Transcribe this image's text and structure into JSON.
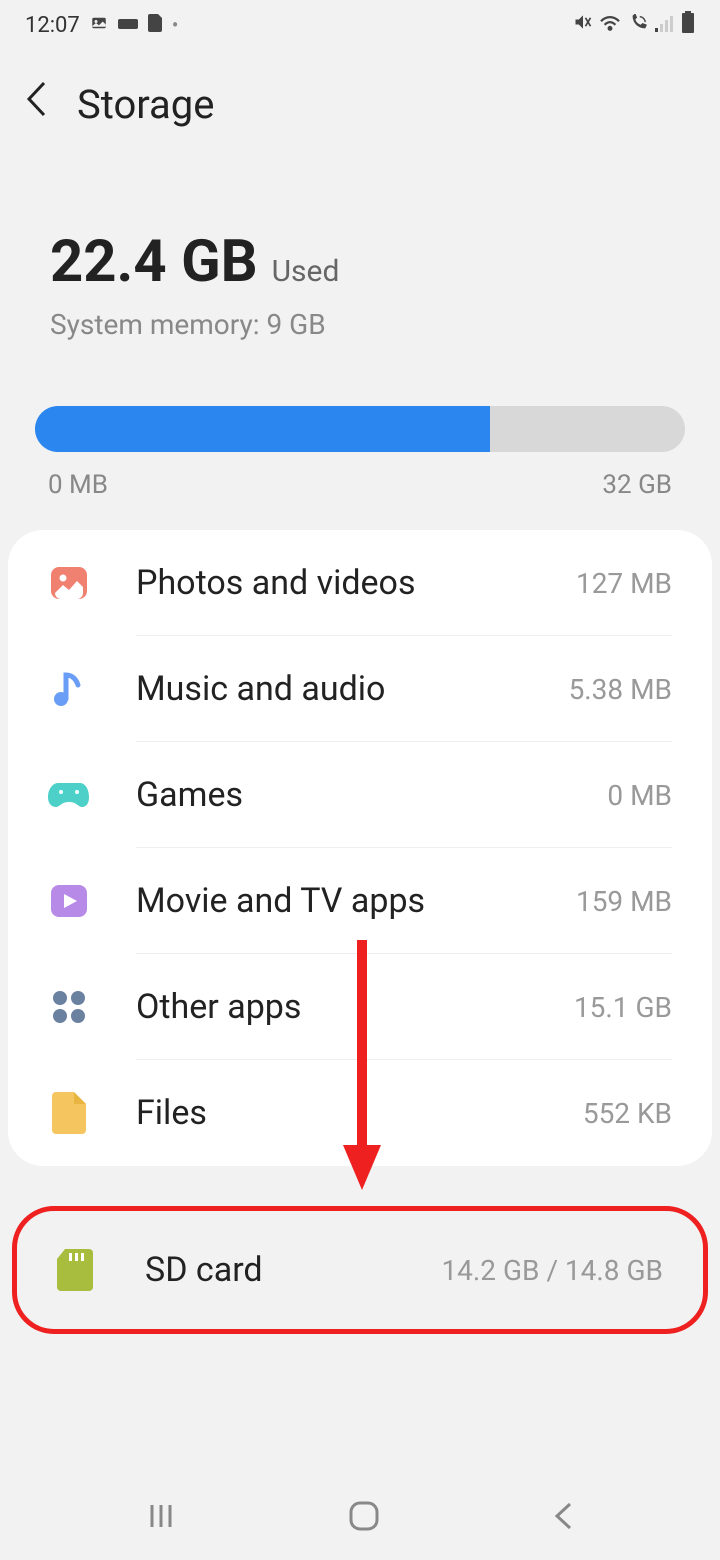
{
  "status_bar": {
    "time": "12:07"
  },
  "header": {
    "title": "Storage"
  },
  "summary": {
    "used_amount": "22.4 GB",
    "used_label": "Used",
    "system_memory": "System memory: 9 GB",
    "progress_percent": 70,
    "min_label": "0 MB",
    "max_label": "32 GB"
  },
  "categories": [
    {
      "id": "photos",
      "label": "Photos and videos",
      "value": "127 MB",
      "color": "#f08070"
    },
    {
      "id": "music",
      "label": "Music and audio",
      "value": "5.38 MB",
      "color": "#6a9df5"
    },
    {
      "id": "games",
      "label": "Games",
      "value": "0 MB",
      "color": "#4cd0c8"
    },
    {
      "id": "movie",
      "label": "Movie and TV apps",
      "value": "159 MB",
      "color": "#b88ae8"
    },
    {
      "id": "other",
      "label": "Other apps",
      "value": "15.1 GB",
      "color": "#6b81a0"
    },
    {
      "id": "files",
      "label": "Files",
      "value": "552 KB",
      "color": "#f5c560"
    }
  ],
  "sd_card": {
    "label": "SD card",
    "value": "14.2 GB / 14.8 GB"
  }
}
